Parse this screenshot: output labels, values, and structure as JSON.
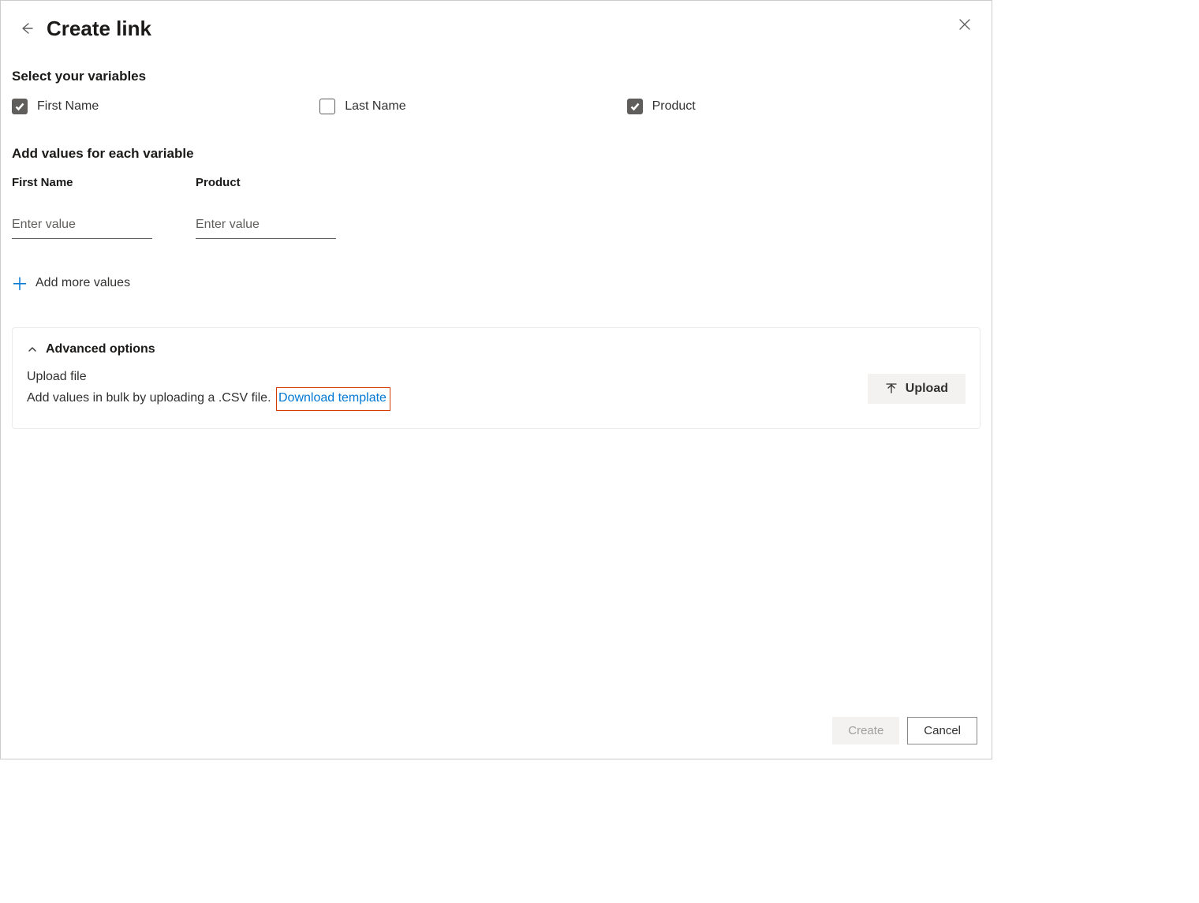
{
  "header": {
    "title": "Create link"
  },
  "select_section": {
    "heading": "Select your variables",
    "options": [
      {
        "label": "First Name",
        "checked": true
      },
      {
        "label": "Last Name",
        "checked": false
      },
      {
        "label": "Product",
        "checked": true
      }
    ]
  },
  "values_section": {
    "heading": "Add values for each variable",
    "columns": [
      {
        "label": "First Name",
        "placeholder": "Enter value"
      },
      {
        "label": "Product",
        "placeholder": "Enter value"
      }
    ],
    "add_more_label": "Add more values"
  },
  "advanced": {
    "title": "Advanced options",
    "upload_title": "Upload file",
    "upload_desc": "Add values in bulk by uploading a .CSV file.",
    "download_link_label": "Download template",
    "upload_button_label": "Upload"
  },
  "footer": {
    "create_label": "Create",
    "cancel_label": "Cancel"
  }
}
